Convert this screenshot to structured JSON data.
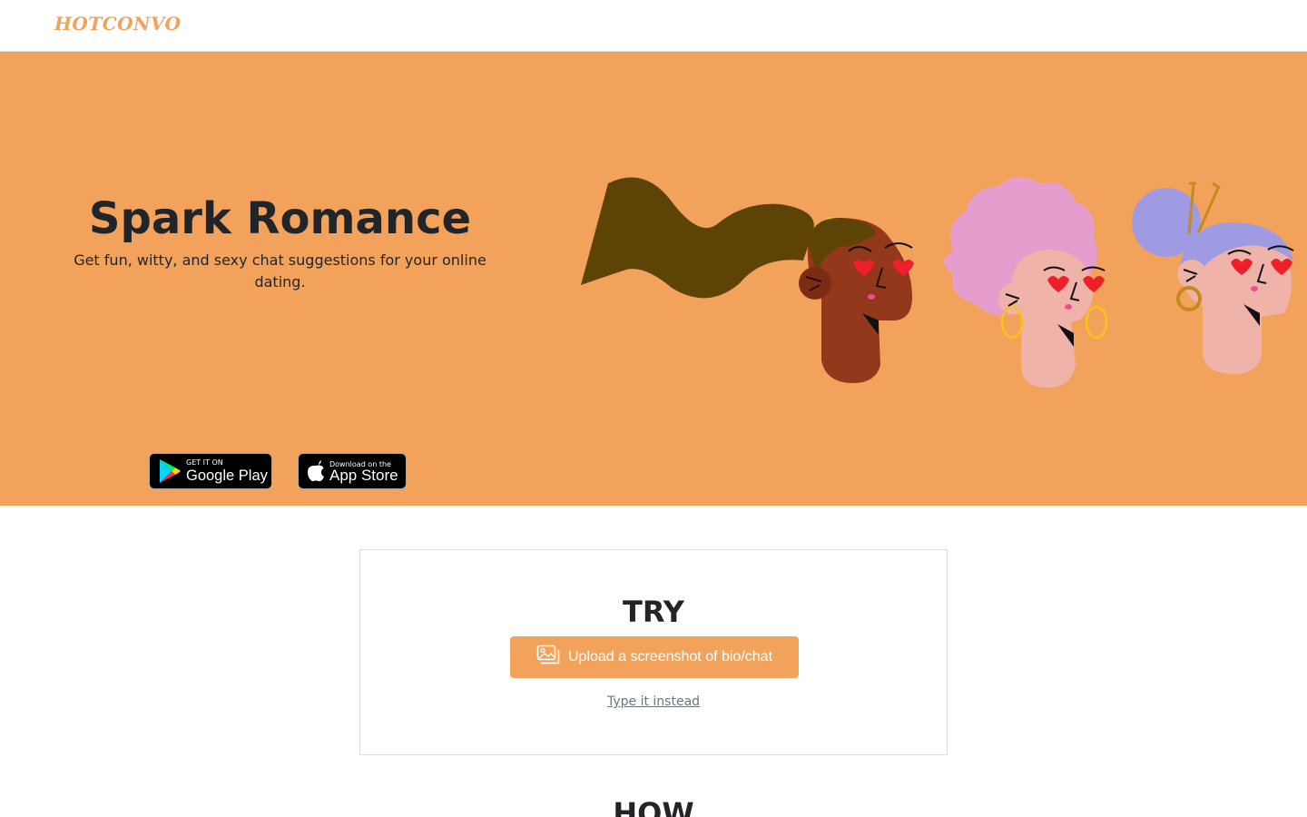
{
  "navbar": {
    "brand": "HOTCONVO"
  },
  "hero": {
    "title": "Spark Romance",
    "subtitle": "Get fun, witty, and sexy chat suggestions for your online dating.",
    "google_play": {
      "small": "GET IT ON",
      "big": "Google Play"
    },
    "app_store": {
      "small": "Download on the",
      "big": "App Store"
    },
    "background_color": "#f3a25c"
  },
  "try_section": {
    "title": "TRY",
    "upload_label": "Upload a screenshot of bio/chat",
    "upload_icon": "image-icon",
    "type_link": "Type it instead"
  },
  "how_section": {
    "title": "HOW"
  },
  "colors": {
    "accent": "#f3a25c",
    "text": "#212529",
    "muted": "#6c757d"
  }
}
